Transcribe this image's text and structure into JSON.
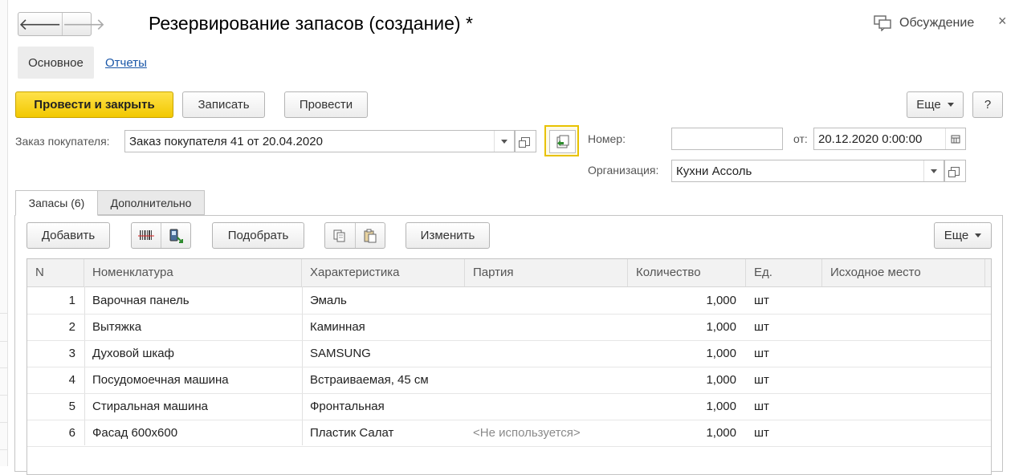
{
  "header": {
    "back_glyph": "🡐",
    "forward_glyph": "🡒",
    "title": "Резервирование запасов (создание) *",
    "discussion": "Обсуждение",
    "close_glyph": "×"
  },
  "sections": {
    "main": "Основное",
    "reports": "Отчеты"
  },
  "toolbar": {
    "post_close": "Провести и закрыть",
    "save": "Записать",
    "post": "Провести",
    "more": "Еще",
    "help": "?"
  },
  "form": {
    "order_label": "Заказ покупателя:",
    "order_value": "Заказ покупателя 41 от 20.04.2020",
    "number_label": "Номер:",
    "number_value": "",
    "date_label": "от:",
    "date_value": "20.12.2020  0:00:00",
    "org_label": "Организация:",
    "org_value": "Кухни Ассоль"
  },
  "tabs": {
    "stocks": "Запасы (6)",
    "additional": "Дополнительно"
  },
  "table_toolbar": {
    "add": "Добавить",
    "pick": "Подобрать",
    "change": "Изменить",
    "more": "Еще"
  },
  "table": {
    "columns": [
      "N",
      "Номенклатура",
      "Характеристика",
      "Партия",
      "Количество",
      "Ед.",
      "Исходное место"
    ],
    "rows": [
      {
        "n": "1",
        "item": "Варочная панель",
        "char": "Эмаль",
        "batch": "",
        "qty": "1,000",
        "unit": "шт",
        "place": ""
      },
      {
        "n": "2",
        "item": "Вытяжка",
        "char": "Каминная",
        "batch": "",
        "qty": "1,000",
        "unit": "шт",
        "place": ""
      },
      {
        "n": "3",
        "item": "Духовой шкаф",
        "char": "SAMSUNG",
        "batch": "",
        "qty": "1,000",
        "unit": "шт",
        "place": ""
      },
      {
        "n": "4",
        "item": "Посудомоечная машина",
        "char": "Встраиваемая, 45 см",
        "batch": "",
        "qty": "1,000",
        "unit": "шт",
        "place": ""
      },
      {
        "n": "5",
        "item": "Стиральная машина",
        "char": "Фронтальная",
        "batch": "",
        "qty": "1,000",
        "unit": "шт",
        "place": ""
      },
      {
        "n": "6",
        "item": "Фасад 600х600",
        "char": "Пластик Салат",
        "batch": "<Не используется>",
        "qty": "1,000",
        "unit": "шт",
        "place": ""
      }
    ]
  },
  "colors": {
    "primary_button": "#f5cc00",
    "link": "#1a57a8",
    "accent_border": "#e8c200"
  }
}
